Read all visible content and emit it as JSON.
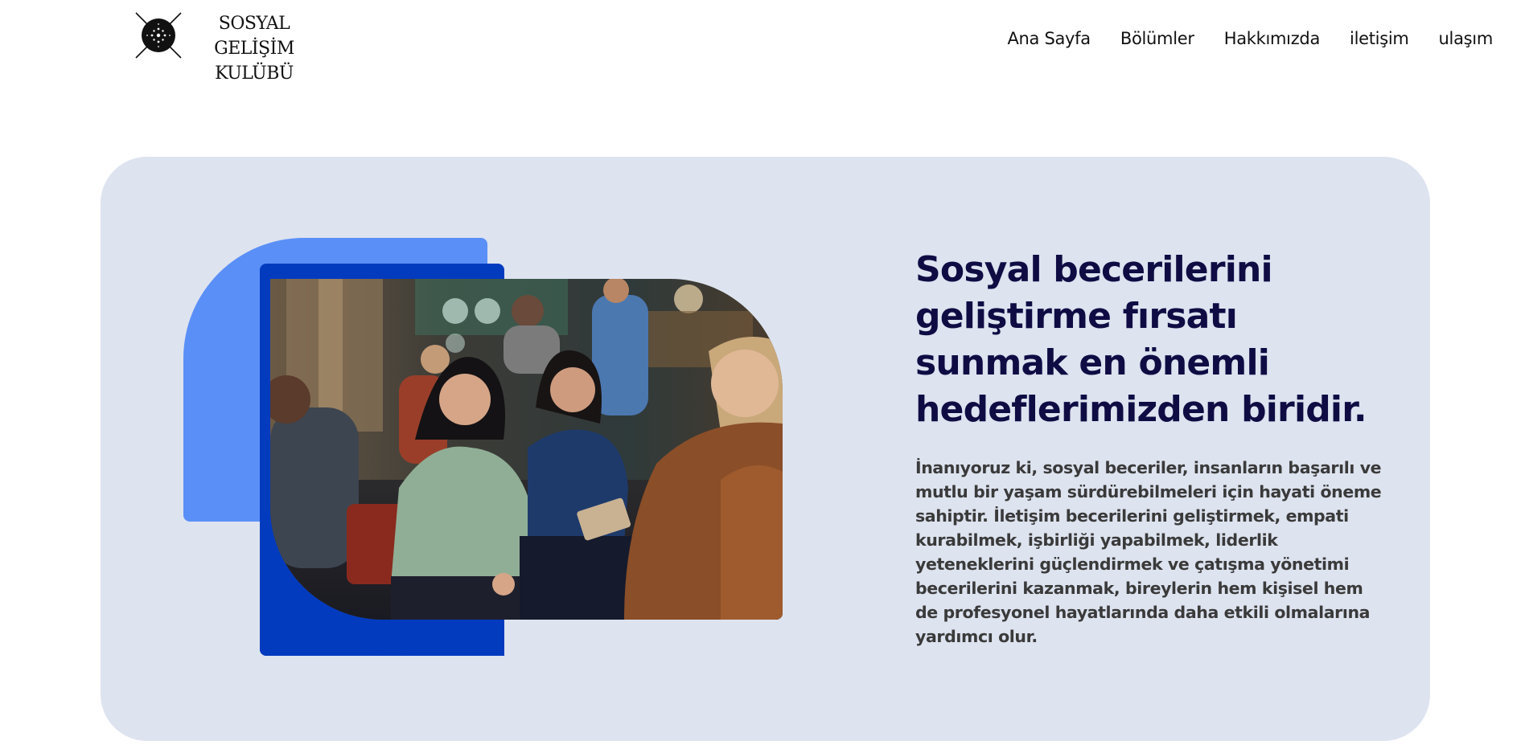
{
  "header": {
    "logo": {
      "line1": "SOSYAL GELİŞİM",
      "line2": "KULÜBÜ",
      "icon": "club-logo-icon"
    },
    "nav": [
      {
        "label": "Ana Sayfa"
      },
      {
        "label": "Bölümler"
      },
      {
        "label": "Hakkımızda"
      },
      {
        "label": "iletişim"
      },
      {
        "label": "ulaşım"
      }
    ]
  },
  "hero": {
    "title": "Sosyal becerilerini geliştirme fırsatı sunmak en önemli hedeflerimizden biridir.",
    "body": "İnanıyoruz ki, sosyal beceriler, insanların başarılı ve mutlu bir yaşam sürdürebilmeleri için hayati öneme sahiptir. İletişim becerilerini geliştirmek, empati kurabilmek, işbirliği yapabilmek, liderlik yeteneklerini güçlendirmek ve çatışma yönetimi becerilerini kazanmak, bireylerin hem kişisel hem de profesyonel hayatlarında daha etkili olmalarına yardımcı olur.",
    "image": "group-discussion-photo"
  },
  "colors": {
    "hero_background": "#dde3ef",
    "accent_light": "#5a8ff7",
    "accent_dark": "#033bbf",
    "title": "#0f0c44",
    "body": "#3a3a3a"
  }
}
